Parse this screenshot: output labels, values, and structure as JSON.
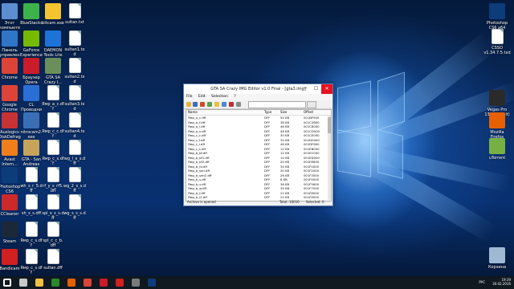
{
  "desktop": {
    "icons_left": [
      {
        "label": "Этот компьютер",
        "icon": "computer-icon",
        "color": "#5b8fd1"
      },
      {
        "label": "BlueStacks",
        "icon": "bluestacks-icon",
        "color": "#3bb34a"
      },
      {
        "label": "bitcam.exe",
        "icon": "exe-icon",
        "color": "#f4c430"
      },
      {
        "label": "sultan.txt",
        "icon": "file-icon",
        "color": "#ffffff"
      },
      {
        "label": "Панель управления",
        "icon": "control-panel-icon",
        "color": "#2f76c6"
      },
      {
        "label": "GeForce Experience",
        "icon": "geforce-icon",
        "color": "#76b900"
      },
      {
        "label": "DAEMON Tools Lite",
        "icon": "daemon-tools-icon",
        "color": "#1e73d8"
      },
      {
        "label": "sultan1.txd",
        "icon": "file-icon",
        "color": "#ffffff"
      },
      {
        "label": "Chrome",
        "icon": "chrome-icon",
        "color": "#db4437"
      },
      {
        "label": "Браузер Opera",
        "icon": "opera-icon",
        "color": "#cc1b2a"
      },
      {
        "label": "GTA SA Crazy I...",
        "icon": "img-tool-icon",
        "color": "#6a8f5a"
      },
      {
        "label": "sultan2.txd",
        "icon": "file-icon",
        "color": "#ffffff"
      },
      {
        "label": "Google Chrome",
        "icon": "chrome-icon",
        "color": "#db4437"
      },
      {
        "label": "CL Проводник",
        "icon": "explorer-icon",
        "color": "#2b6fd6"
      },
      {
        "label": "Ямр_a_c.dff",
        "icon": "file-icon",
        "color": "#ffffff"
      },
      {
        "label": "sultan3.txd",
        "icon": "file-icon",
        "color": "#ffffff"
      },
      {
        "label": "Auslogics DiskDefrag",
        "icon": "defrag-icon",
        "color": "#c83232"
      },
      {
        "label": "nitrocam2.exe",
        "icon": "exe-icon",
        "color": "#3a6fb5"
      },
      {
        "label": "Ямр_c_c.dff",
        "icon": "file-icon",
        "color": "#ffffff"
      },
      {
        "label": "sultan4.txd",
        "icon": "file-icon",
        "color": "#ffffff"
      },
      {
        "label": "Avast Intern...",
        "icon": "avast-icon",
        "color": "#f07f1b"
      },
      {
        "label": "GTA - San Andreas",
        "icon": "gta-icon",
        "color": "#c8a45a"
      },
      {
        "label": "Ямр_c_s.dff",
        "icon": "file-icon",
        "color": "#ffffff"
      },
      {
        "label": "wg_l_x_s.dff",
        "icon": "file-icon",
        "color": "#ffffff"
      },
      {
        "label": "Photoshop CS6",
        "icon": "photoshop-icon",
        "color": "#0d3c7a"
      },
      {
        "label": "wh_s_r_5.dff",
        "icon": "file-icon",
        "color": "#ffffff"
      },
      {
        "label": "rf_y_s_rf5.dff",
        "icon": "file-icon",
        "color": "#ffffff"
      },
      {
        "label": "wg_2_s_s.dff",
        "icon": "file-icon",
        "color": "#ffffff"
      },
      {
        "label": "CCleaner",
        "icon": "ccleaner-icon",
        "color": "#cc2a2a"
      },
      {
        "label": "sh_s_s.dff",
        "icon": "file-icon",
        "color": "#ffffff"
      },
      {
        "label": "spl_s_s_s.dff",
        "icon": "file-icon",
        "color": "#ffffff"
      },
      {
        "label": "wg_s_s_s.dff",
        "icon": "file-icon",
        "color": "#ffffff"
      },
      {
        "label": "Steam",
        "icon": "steam-icon",
        "color": "#1b2838"
      },
      {
        "label": "Ямр_c_s.dff",
        "icon": "file-icon",
        "color": "#ffffff"
      },
      {
        "label": "spl_c_c_b.dff",
        "icon": "file-icon",
        "color": "#ffffff"
      },
      {
        "label": "",
        "icon": "blank",
        "color": "transparent"
      },
      {
        "label": "Bandicam",
        "icon": "bandicam-icon",
        "color": "#d02020"
      },
      {
        "label": "Ямр_c_s.dff",
        "icon": "file-icon",
        "color": "#ffffff"
      },
      {
        "label": "sultan.dff",
        "icon": "file-icon",
        "color": "#ffffff"
      }
    ],
    "icons_right": [
      {
        "label": "Photoshop CS6 x64",
        "icon": "photoshop-icon",
        "color": "#0d3c7a"
      },
      {
        "label": "CSSO v1.34.7.5.txd",
        "icon": "file-icon",
        "color": "#ffffff"
      },
      {
        "label": "Vegas Pro 13.0 (64-bit)",
        "icon": "vegas-icon",
        "color": "#2a2a2a"
      },
      {
        "label": "Mozilla Firefox",
        "icon": "firefox-icon",
        "color": "#e66000"
      },
      {
        "label": "uTorrent",
        "icon": "utorrent-icon",
        "color": "#76b043"
      },
      {
        "label": "Корзина",
        "icon": "recycle-bin-icon",
        "color": "#9fb8d4"
      }
    ]
  },
  "window": {
    "title": "GTA SA Crazy IMG Editor v1.0 Final - [gta3.img]",
    "minimize": "─",
    "maximize": "☐",
    "close": "✕",
    "menu": [
      "File",
      "Edit",
      "Selection",
      "?"
    ],
    "columns": [
      "Name",
      "Type",
      "Size",
      "Offset"
    ],
    "rows": [
      [
        "Ямр_a_c.dff",
        "DFF",
        "54 KB",
        "001BF000"
      ],
      [
        "Ямр_a_f.dff",
        "DFF",
        "38 KB",
        "001C3800"
      ],
      [
        "Ямр_a_i.dff",
        "DFF",
        "46 KB",
        "001C6000"
      ],
      [
        "Ямр_a_s.dff",
        "DFF",
        "46 KB",
        "001CD000"
      ],
      [
        "Ямр_c_c.dff",
        "DFF",
        "30 KB",
        "001CE000"
      ],
      [
        "Ямр_c_f.dff",
        "DFF",
        "34 KB",
        "001D0000"
      ],
      [
        "Ямр_c_i.dff",
        "DFF",
        "46 KB",
        "001DF800"
      ],
      [
        "Ямр_c_s.dff",
        "DFF",
        "12 KB",
        "001EB000"
      ],
      [
        "Ямр_b_bf.dff",
        "DFF",
        "12 KB",
        "001EC000"
      ],
      [
        "Ямр_b_bf1.dff",
        "DFF",
        "14 KB",
        "001ED000"
      ],
      [
        "Ямр_b_bf2.dff",
        "DFF",
        "20 KB",
        "001EE800"
      ],
      [
        "Ямр_b_fo.dff",
        "DFF",
        "34 KB",
        "001F0000"
      ],
      [
        "Ямр_b_sen.dff",
        "DFF",
        "30 KB",
        "001F2000"
      ],
      [
        "Ямр_b_sen2.dff",
        "DFF",
        "26 KB",
        "001F3000"
      ],
      [
        "Ямр_b_s.dff",
        "DFF",
        "6 KB",
        "001F5000"
      ],
      [
        "Ямр_b_v.dff",
        "DFF",
        "36 KB",
        "001F5800"
      ],
      [
        "Ямр_b_w.dff",
        "DFF",
        "34 KB",
        "001F7000"
      ],
      [
        "Ямр_b_f.dff",
        "DFF",
        "22 KB",
        "001F8000"
      ],
      [
        "Ямр_b_l2.dff",
        "DFF",
        "24 KB",
        "001F9000"
      ]
    ],
    "status_left": "Archive is opened",
    "status_total": "Total: 16016",
    "status_selected": "Selected: 0"
  },
  "taskbar": {
    "apps": [
      {
        "icon": "start-icon",
        "color": "#ffffff"
      },
      {
        "icon": "task-view-icon",
        "color": "#c8c8c8"
      },
      {
        "icon": "explorer-icon",
        "color": "#f0c040"
      },
      {
        "icon": "store-icon",
        "color": "#2a8a2a"
      },
      {
        "icon": "firefox-icon",
        "color": "#e66000"
      },
      {
        "icon": "chrome-icon",
        "color": "#db4437"
      },
      {
        "icon": "opera-icon",
        "color": "#cc1b2a"
      },
      {
        "icon": "record-icon",
        "color": "#d02020"
      },
      {
        "icon": "img-tool-icon",
        "color": "#7a7a7a"
      },
      {
        "icon": "photoshop-icon",
        "color": "#0d3c7a"
      }
    ],
    "lang": "РУС",
    "time": "19:39",
    "date": "30.02.2016"
  }
}
